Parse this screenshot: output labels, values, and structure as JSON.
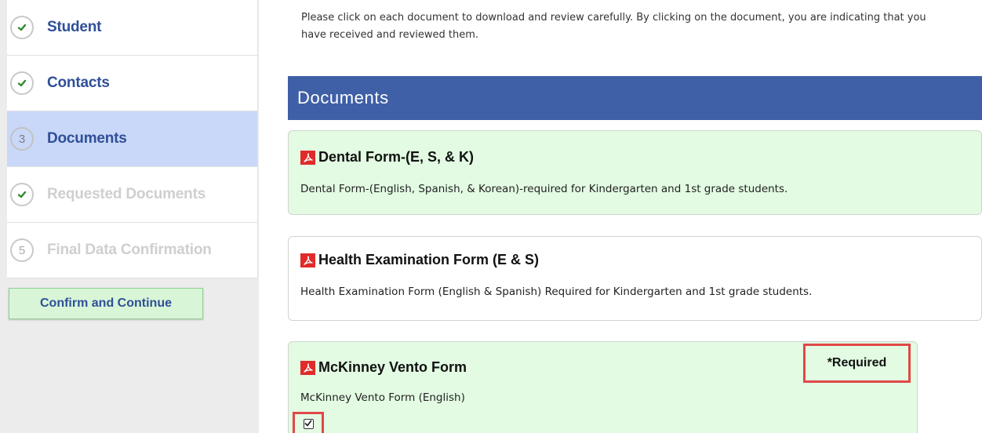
{
  "sidebar": {
    "steps": [
      {
        "indicator": "check",
        "label": "Student",
        "state": "done"
      },
      {
        "indicator": "check",
        "label": "Contacts",
        "state": "done"
      },
      {
        "indicator": "3",
        "label": "Documents",
        "state": "active"
      },
      {
        "indicator": "check",
        "label": "Requested Documents",
        "state": "pending"
      },
      {
        "indicator": "5",
        "label": "Final Data Confirmation",
        "state": "pending"
      }
    ],
    "confirm_button": "Confirm and Continue"
  },
  "main": {
    "instructions": "Please click on each document to download and review carefully. By clicking on the document, you are indicating that you have received and reviewed them.",
    "section_title": "Documents",
    "documents": [
      {
        "title": "Dental Form-(E, S, & K)",
        "description": "Dental Form-(English, Spanish, & Korean)-required for Kindergarten and 1st grade students.",
        "icon": "pdf-icon"
      },
      {
        "title": "Health Examination Form (E & S)",
        "description": "Health Examination Form (English & Spanish) Required for Kindergarten and 1st grade students.",
        "icon": "pdf-icon"
      },
      {
        "title": "McKinney Vento Form",
        "description": "McKinney Vento Form (English)",
        "icon": "pdf-icon",
        "badge": "*Required",
        "checked": true
      }
    ]
  },
  "colors": {
    "header_blue": "#3f5fa6",
    "nav_text": "#2f4f97",
    "active_step": "#c9d8f8",
    "card_green": "#e2fbe2",
    "pdf_red": "#e02b2b",
    "highlight_red": "#e04848",
    "check_green": "#2e8b2e"
  }
}
